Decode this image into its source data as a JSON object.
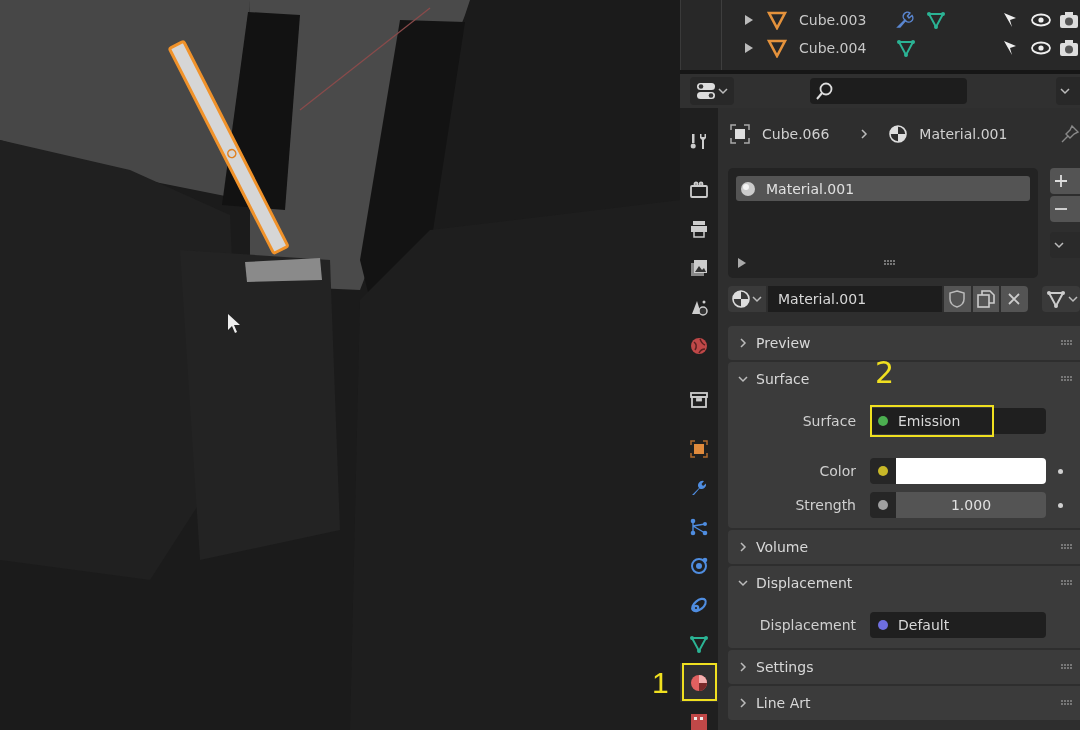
{
  "outliner": {
    "rows": [
      {
        "name": "Cube.003",
        "has_modifier": true,
        "has_mesh": true
      },
      {
        "name": "Cube.004",
        "has_modifier": false,
        "has_mesh": true
      }
    ]
  },
  "properties": {
    "tab_groups": [
      [
        {
          "kind": "tool",
          "selected": false
        }
      ],
      [
        {
          "kind": "render",
          "selected": false
        },
        {
          "kind": "output",
          "selected": false
        },
        {
          "kind": "view_layer",
          "selected": false
        },
        {
          "kind": "scene",
          "selected": false
        },
        {
          "kind": "world",
          "selected": false
        }
      ],
      [
        {
          "kind": "collection",
          "selected": false
        }
      ],
      [
        {
          "kind": "object",
          "selected": false
        },
        {
          "kind": "modifiers",
          "selected": false
        },
        {
          "kind": "particles",
          "selected": false
        },
        {
          "kind": "physics",
          "selected": false
        },
        {
          "kind": "constraints",
          "selected": false
        },
        {
          "kind": "data",
          "selected": false
        },
        {
          "kind": "material",
          "selected": true,
          "annotation": "1"
        },
        {
          "kind": "texture",
          "selected": false
        }
      ]
    ],
    "breadcrumb": {
      "object": "Cube.066",
      "material": "Material.001"
    },
    "slots": [
      {
        "name": "Material.001",
        "selected": true
      }
    ],
    "material_name": "Material.001",
    "panels": [
      {
        "title": "Preview",
        "expanded": false
      },
      {
        "title": "Surface",
        "expanded": true,
        "fields": [
          {
            "kind": "shader",
            "label": "Surface",
            "value": "Emission",
            "color": "#4caf50",
            "annotation": "2"
          },
          {
            "kind": "swatch",
            "label": "Color",
            "color": "#c8b828",
            "swatch": {
              "color": "#ffffff"
            }
          },
          {
            "kind": "number",
            "label": "Strength",
            "color": "#a0a0a0",
            "value": "1.000"
          }
        ]
      },
      {
        "title": "Volume",
        "expanded": false
      },
      {
        "title": "Displacement",
        "expanded": true,
        "fields": [
          {
            "kind": "shader",
            "label": "Displacement",
            "value": "Default",
            "color": "#6e6ee0"
          }
        ]
      },
      {
        "title": "Settings",
        "expanded": false
      },
      {
        "title": "Line Art",
        "expanded": false
      }
    ]
  }
}
